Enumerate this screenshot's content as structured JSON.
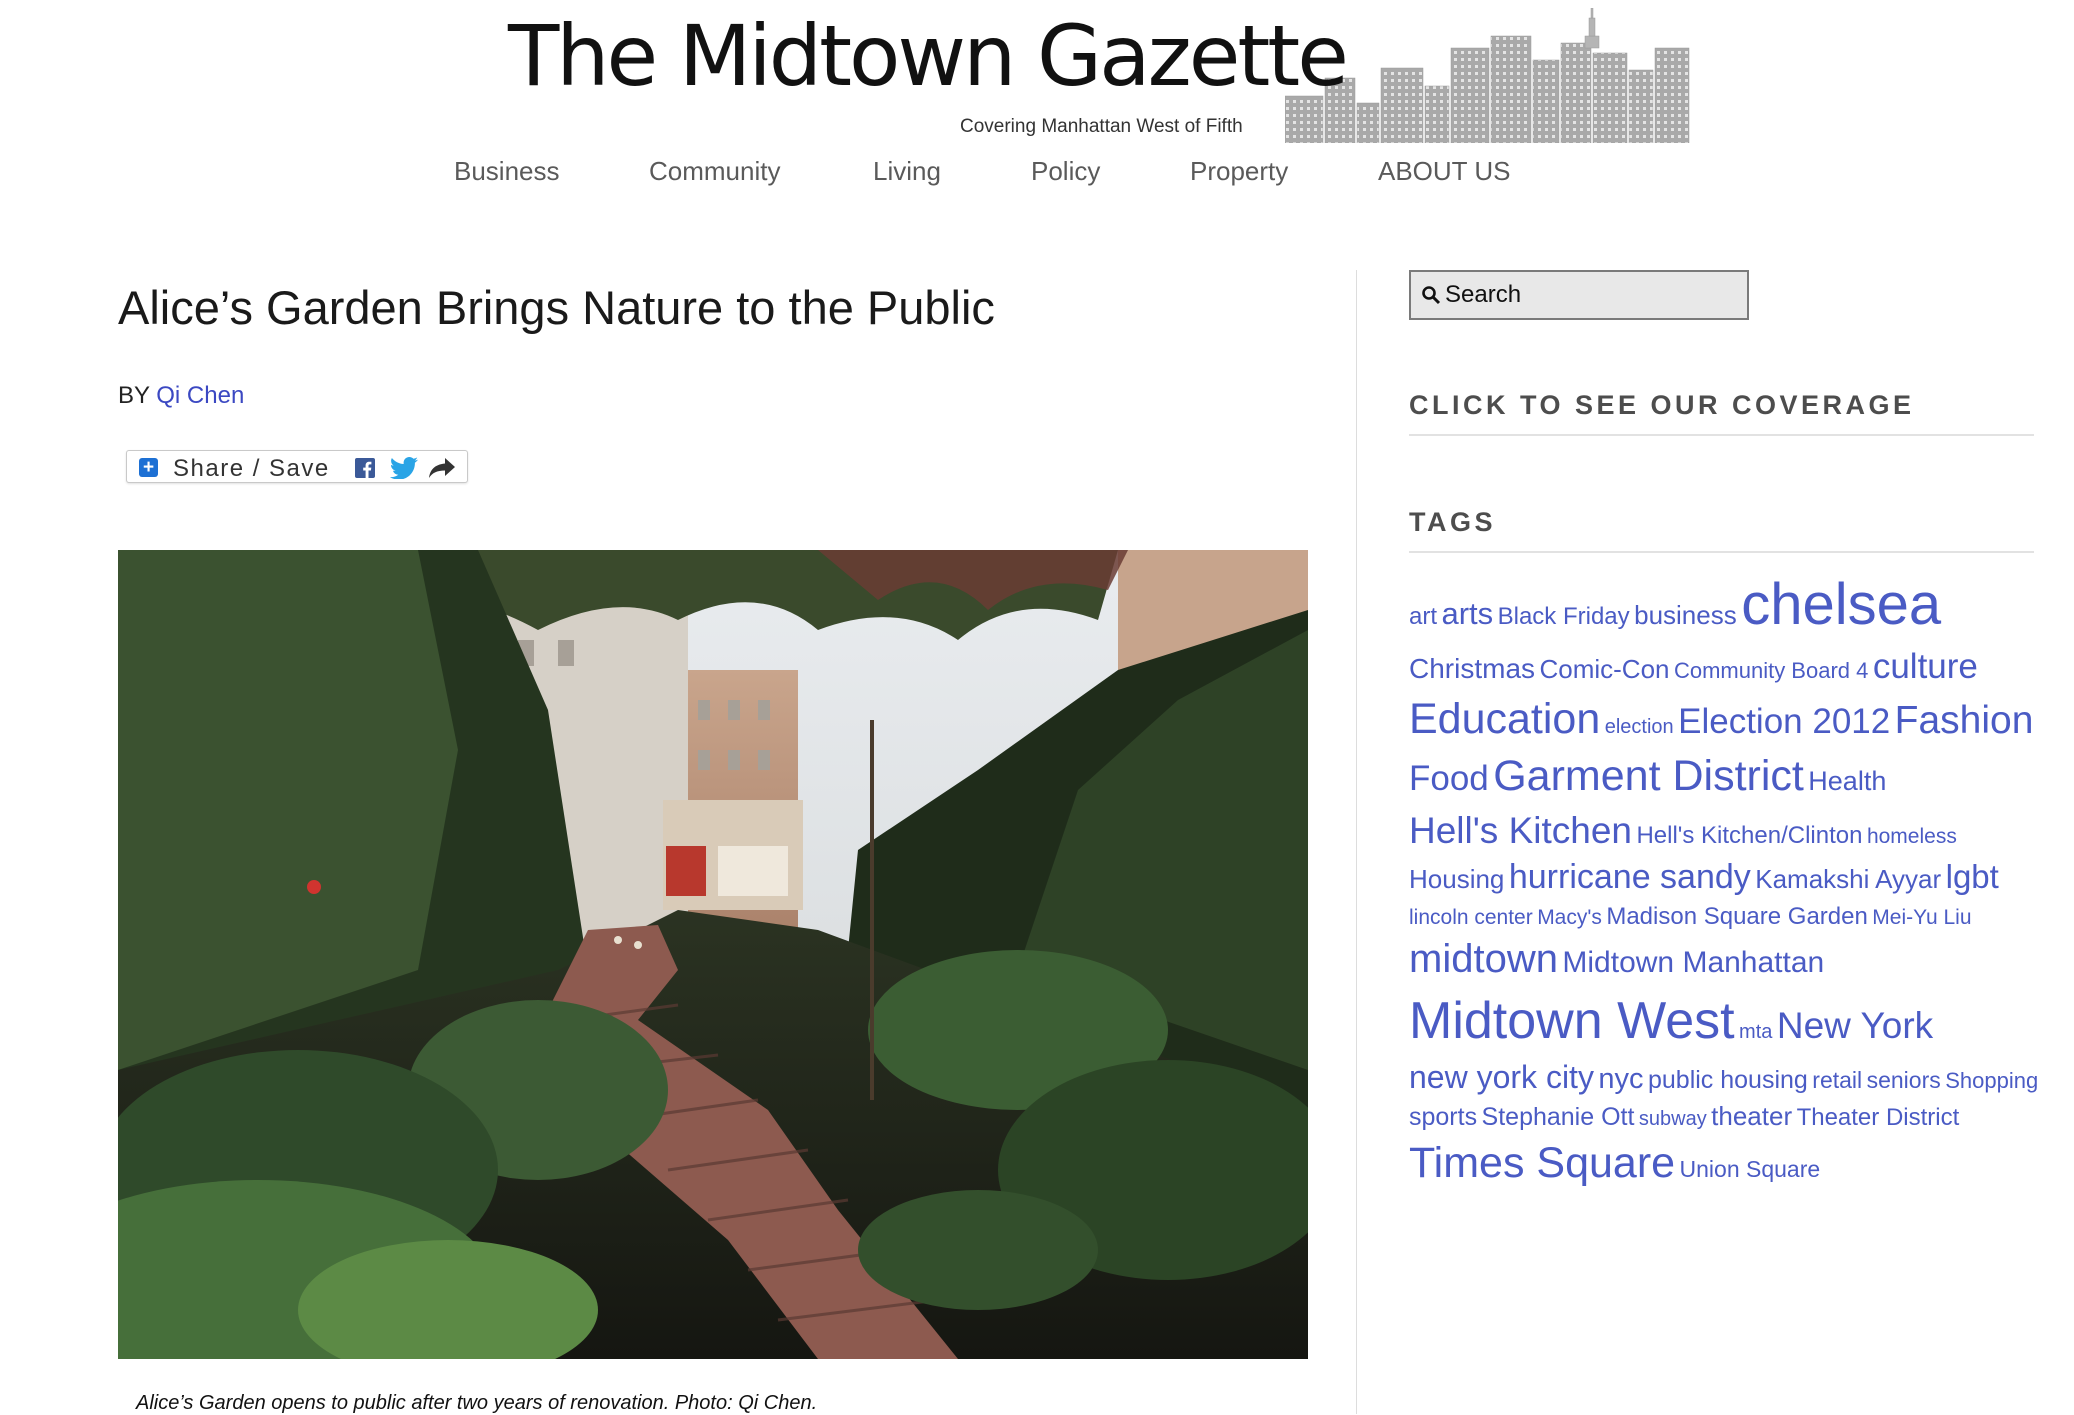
{
  "site": {
    "title": "The Midtown Gazette",
    "tagline": "Covering Manhattan West of Fifth"
  },
  "nav": [
    {
      "label": "Business"
    },
    {
      "label": "Community"
    },
    {
      "label": "Living"
    },
    {
      "label": "Policy"
    },
    {
      "label": "Property"
    },
    {
      "label": "ABOUT US"
    }
  ],
  "article": {
    "title": "Alice’s Garden Brings Nature to the Public",
    "byline_prefix": "BY",
    "author": "Qi Chen",
    "share_label": "Share / Save",
    "photo_caption": "Alice’s Garden opens to public after two years of renovation. Photo: Qi Chen."
  },
  "sidebar": {
    "search_placeholder": "Search",
    "coverage_heading": "CLICK TO SEE OUR COVERAGE",
    "tags_heading": "TAGS",
    "tags": [
      {
        "label": "art",
        "size": 24
      },
      {
        "label": "arts",
        "size": 31
      },
      {
        "label": "Black Friday",
        "size": 24
      },
      {
        "label": "business",
        "size": 26
      },
      {
        "label": "chelsea",
        "size": 58
      },
      {
        "label": "Christmas",
        "size": 28
      },
      {
        "label": "Comic-Con",
        "size": 26
      },
      {
        "label": "Community Board 4",
        "size": 22
      },
      {
        "label": "culture",
        "size": 35
      },
      {
        "label": "Education",
        "size": 43
      },
      {
        "label": "election",
        "size": 20
      },
      {
        "label": "Election 2012",
        "size": 35
      },
      {
        "label": "Fashion",
        "size": 39
      },
      {
        "label": "Food",
        "size": 35
      },
      {
        "label": "Garment District",
        "size": 43
      },
      {
        "label": "Health",
        "size": 27
      },
      {
        "label": "Hell's Kitchen",
        "size": 37
      },
      {
        "label": "Hell's Kitchen/Clinton",
        "size": 24
      },
      {
        "label": "homeless",
        "size": 21
      },
      {
        "label": "Housing",
        "size": 26
      },
      {
        "label": "hurricane sandy",
        "size": 34
      },
      {
        "label": "Kamakshi Ayyar",
        "size": 26
      },
      {
        "label": "lgbt",
        "size": 33
      },
      {
        "label": "lincoln center",
        "size": 21
      },
      {
        "label": "Macy's",
        "size": 21
      },
      {
        "label": "Madison Square Garden",
        "size": 24
      },
      {
        "label": "Mei-Yu Liu",
        "size": 21
      },
      {
        "label": "midtown",
        "size": 40
      },
      {
        "label": "Midtown Manhattan",
        "size": 30
      },
      {
        "label": "Midtown West",
        "size": 52
      },
      {
        "label": "mta",
        "size": 20
      },
      {
        "label": "New York",
        "size": 37
      },
      {
        "label": "new york city",
        "size": 32
      },
      {
        "label": "nyc",
        "size": 29
      },
      {
        "label": "public housing",
        "size": 25
      },
      {
        "label": "retail",
        "size": 23
      },
      {
        "label": "seniors",
        "size": 23
      },
      {
        "label": "Shopping",
        "size": 22
      },
      {
        "label": "sports",
        "size": 25
      },
      {
        "label": "Stephanie Ott",
        "size": 25
      },
      {
        "label": "subway",
        "size": 20
      },
      {
        "label": "theater",
        "size": 26
      },
      {
        "label": "Theater District",
        "size": 24
      },
      {
        "label": "Times Square",
        "size": 43
      },
      {
        "label": "Union Square",
        "size": 23
      }
    ]
  },
  "colors": {
    "link": "#3b48c2",
    "tag": "#4a5bc4",
    "nav_text": "#5a5a5a",
    "heading_gray": "#4d4d4d"
  }
}
